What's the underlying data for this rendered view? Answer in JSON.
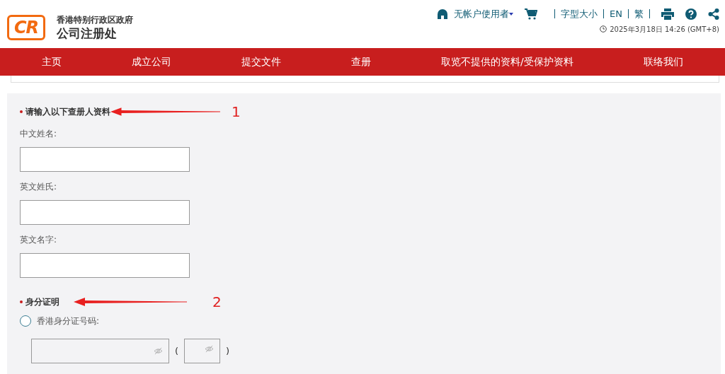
{
  "header": {
    "logo": "CR",
    "government": "香港特别行政区政府",
    "office": "公司注册处",
    "user": "无帐户使用者",
    "links": [
      "字型大小",
      "EN",
      "繁"
    ],
    "datetime": "2025年3月18日 14:26 (GMT+8)"
  },
  "nav": [
    "主页",
    "成立公司",
    "提交文件",
    "查册",
    "取览不提供的资料/受保护资料",
    "联络我们"
  ],
  "form": {
    "sections": [
      {
        "title": "请输入以下查册人资料",
        "annotation": "1",
        "fields": [
          {
            "label": "中文姓名:"
          },
          {
            "label": "英文姓氏:"
          },
          {
            "label": "英文名字:"
          }
        ]
      },
      {
        "title": "身分证明",
        "annotation": "2",
        "options": [
          {
            "label": "香港身分证号码:",
            "selected": false,
            "open": "(",
            "close": ")"
          }
        ]
      }
    ]
  }
}
